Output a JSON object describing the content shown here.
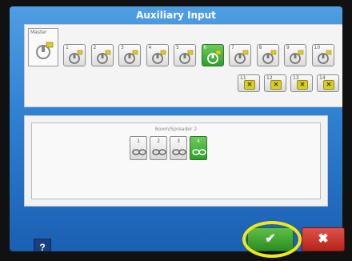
{
  "title": "Auxiliary Input",
  "master_label": "Master",
  "inputs": [
    {
      "num": "1",
      "active": false
    },
    {
      "num": "2",
      "active": false
    },
    {
      "num": "3",
      "active": false
    },
    {
      "num": "4",
      "active": false
    },
    {
      "num": "5",
      "active": false
    },
    {
      "num": "6",
      "active": true
    },
    {
      "num": "7",
      "active": false
    },
    {
      "num": "8",
      "active": false
    },
    {
      "num": "9",
      "active": false
    },
    {
      "num": "10",
      "active": false
    }
  ],
  "aux_inputs": [
    {
      "num": "11"
    },
    {
      "num": "12"
    },
    {
      "num": "13"
    },
    {
      "num": "14"
    }
  ],
  "boom_label": "Boom/Spreader 2",
  "sections": [
    {
      "num": "1",
      "active": false
    },
    {
      "num": "2",
      "active": false
    },
    {
      "num": "3",
      "active": false
    },
    {
      "num": "4",
      "active": true
    }
  ],
  "help_label": "?",
  "ok_icon": "check-icon",
  "cancel_icon": "close-icon",
  "colors": {
    "active_green": "#3aa935",
    "ok_green": "#2b8d22",
    "cancel_red": "#c0271f",
    "highlight_yellow": "#f2e71b",
    "screen_blue": "#2f80d2"
  }
}
